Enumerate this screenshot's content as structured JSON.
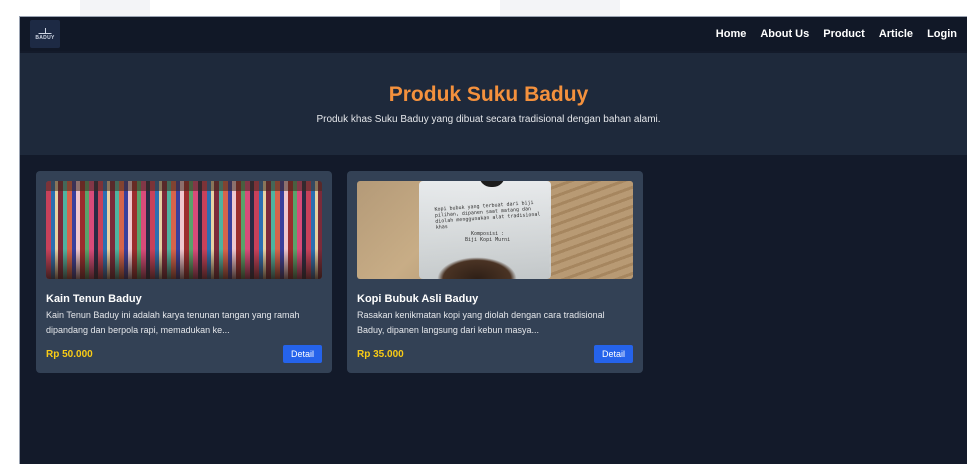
{
  "nav": {
    "logo_text": "BADUY",
    "links": [
      "Home",
      "About Us",
      "Product",
      "Article",
      "Login"
    ]
  },
  "hero": {
    "title": "Produk Suku Baduy",
    "subtitle": "Produk khas Suku Baduy yang dibuat secara tradisional dengan bahan alami."
  },
  "products": [
    {
      "name": "Kain Tenun Baduy",
      "description": "Kain Tenun Baduy ini adalah karya tenunan tangan yang ramah dipandang dan berpola rapi, memadukan ke...",
      "price": "Rp 50.000",
      "button": "Detail"
    },
    {
      "name": "Kopi Bubuk Asli Baduy",
      "description": "Rasakan kenikmatan kopi yang diolah dengan cara tradisional Baduy, dipanen langsung dari kebun masya...",
      "price": "Rp 35.000",
      "button": "Detail"
    }
  ],
  "kopi_label": {
    "text": "Kopi bubuk yang terbuat dari biji pilihan, dipanen saat matang dan diolah menggunakan alat tradisional khas",
    "composition": "Komposisi :",
    "ingredient": "Biji Kopi Murni"
  },
  "colors": {
    "hero_title": "#f4913d",
    "price": "#facc15",
    "button": "#2563eb",
    "card_bg": "#334155",
    "page_bg": "#131a2a"
  }
}
